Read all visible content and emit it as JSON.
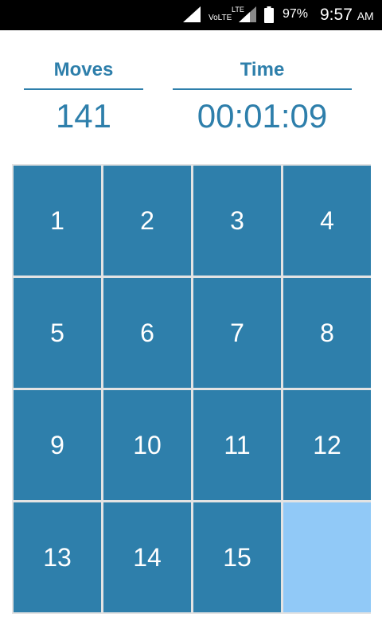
{
  "status_bar": {
    "network_label": "VoLTE",
    "lte_label": "LTE",
    "battery": "97%",
    "time": "9:57",
    "ampm": "AM",
    "icons": [
      "wifi-signal-icon",
      "cell-signal-icon",
      "battery-icon"
    ]
  },
  "stats": {
    "moves_label": "Moves",
    "moves_value": "141",
    "time_label": "Time",
    "time_value": "00:01:09"
  },
  "board": {
    "rows": 4,
    "cols": 4,
    "tiles": [
      "1",
      "2",
      "3",
      "4",
      "5",
      "6",
      "7",
      "8",
      "9",
      "10",
      "11",
      "12",
      "13",
      "14",
      "15",
      ""
    ],
    "tile_color": "#2e7fab",
    "empty_color": "#91c9f7"
  },
  "colors": {
    "accent": "#2e7fab",
    "background": "#ffffff",
    "board_background": "#e3e3e3"
  }
}
